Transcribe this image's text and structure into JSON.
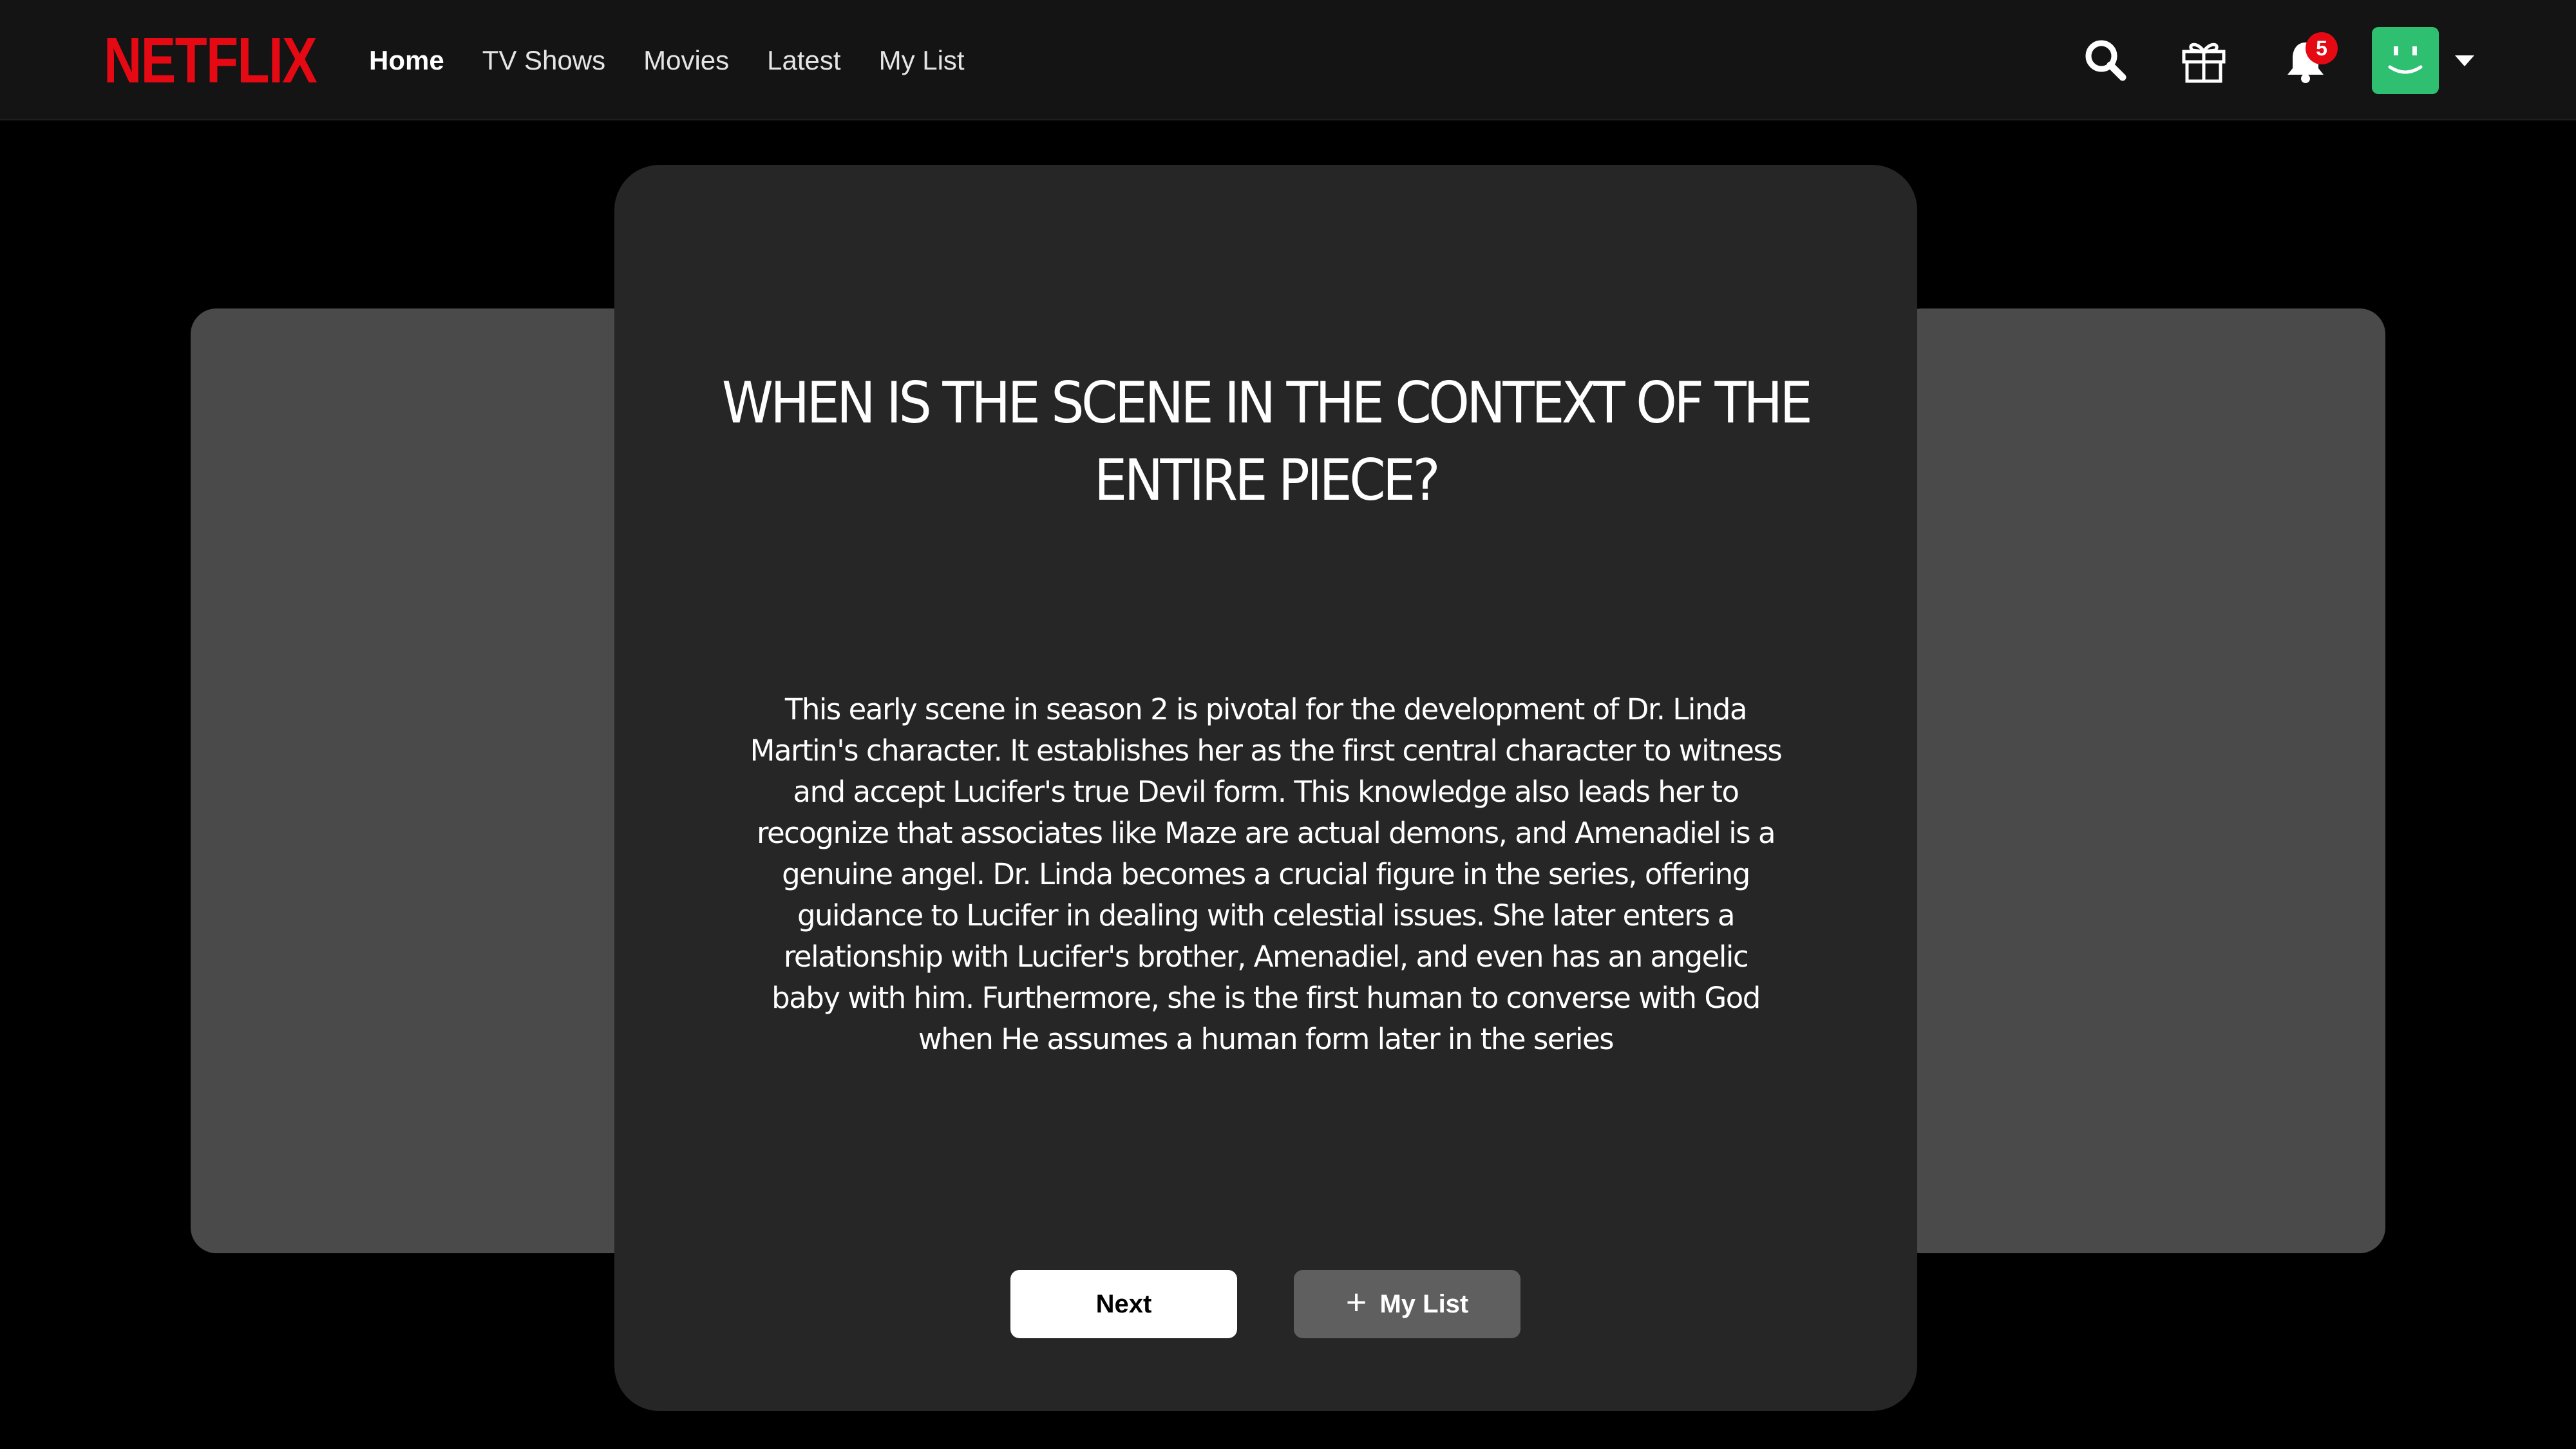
{
  "header": {
    "logo": "NETFLIX",
    "nav": [
      {
        "label": "Home",
        "active": true
      },
      {
        "label": "TV Shows",
        "active": false
      },
      {
        "label": "Movies",
        "active": false
      },
      {
        "label": "Latest",
        "active": false
      },
      {
        "label": "My List",
        "active": false
      }
    ],
    "icons": [
      "search-icon",
      "gift-icon",
      "bell-icon",
      "avatar",
      "caret-down-icon"
    ],
    "notification_count": "5"
  },
  "card": {
    "question": "WHEN IS THE SCENE IN THE CONTEXT OF THE ENTIRE PIECE?",
    "answer": "This early scene in season 2 is pivotal for the development of Dr. Linda Martin's character. It establishes her as the first central character to witness and accept Lucifer's true Devil form. This knowledge also leads her to recognize that associates like Maze are actual demons, and Amenadiel is a genuine angel. Dr. Linda becomes a crucial figure in the series, offering guidance to Lucifer in dealing with celestial issues. She later enters a relationship with Lucifer's brother, Amenadiel, and even has an angelic baby with him. Furthermore, she is the first human to converse with God when He assumes a human form later in the series",
    "next_label": "Next",
    "mylist_label": "My List"
  },
  "colors": {
    "brand": "#e50914",
    "background": "#000000",
    "header": "#141414",
    "card": "#262626",
    "side_card": "#4a4a4a",
    "avatar": "#2fbf71"
  }
}
